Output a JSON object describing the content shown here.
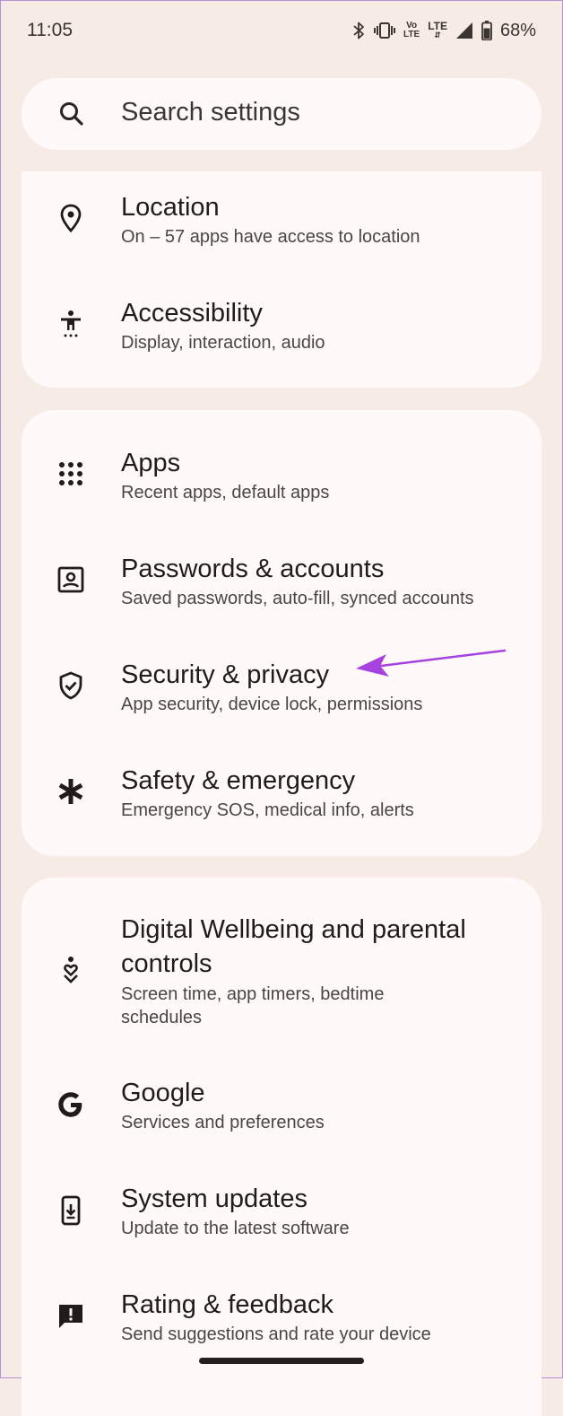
{
  "status_bar": {
    "time": "11:05",
    "volte_top": "Vo",
    "volte_bottom": "LTE",
    "lte_label": "LTE",
    "battery_percent": "68%",
    "icons": [
      "bluetooth-icon",
      "vibrate-icon",
      "volte-icon",
      "lte-icon",
      "signal-icon",
      "battery-icon"
    ]
  },
  "search": {
    "placeholder": "Search settings",
    "icon": "search-icon"
  },
  "groups": [
    {
      "items": [
        {
          "icon": "location-pin-icon",
          "title": "Location",
          "subtitle": "On – 57 apps have access to location"
        },
        {
          "icon": "accessibility-icon",
          "title": "Accessibility",
          "subtitle": "Display, interaction, audio"
        }
      ]
    },
    {
      "items": [
        {
          "icon": "apps-grid-icon",
          "title": "Apps",
          "subtitle": "Recent apps, default apps"
        },
        {
          "icon": "account-box-icon",
          "title": "Passwords & accounts",
          "subtitle": "Saved passwords, auto-fill, synced accounts"
        },
        {
          "icon": "shield-check-icon",
          "title": "Security & privacy",
          "subtitle": "App security, device lock, permissions"
        },
        {
          "icon": "asterisk-icon",
          "title": "Safety & emergency",
          "subtitle": "Emergency SOS, medical info, alerts"
        }
      ]
    },
    {
      "items": [
        {
          "icon": "wellbeing-icon",
          "title_line1": "Digital Wellbeing and parental",
          "title_line2": "controls",
          "subtitle_line1": "Screen time, app timers, bedtime",
          "subtitle_line2": "schedules"
        },
        {
          "icon": "google-g-icon",
          "title": "Google",
          "subtitle": "Services and preferences"
        },
        {
          "icon": "system-update-icon",
          "title": "System updates",
          "subtitle": "Update to the latest software"
        },
        {
          "icon": "feedback-icon",
          "title": "Rating & feedback",
          "subtitle": "Send suggestions and rate your device"
        }
      ]
    }
  ],
  "annotation": {
    "color": "#a542e0",
    "target": "Security & privacy"
  },
  "colors": {
    "background": "#f7ebe6",
    "card": "#fffaf9",
    "text": "#211b1a",
    "subtext": "#4c4442"
  }
}
